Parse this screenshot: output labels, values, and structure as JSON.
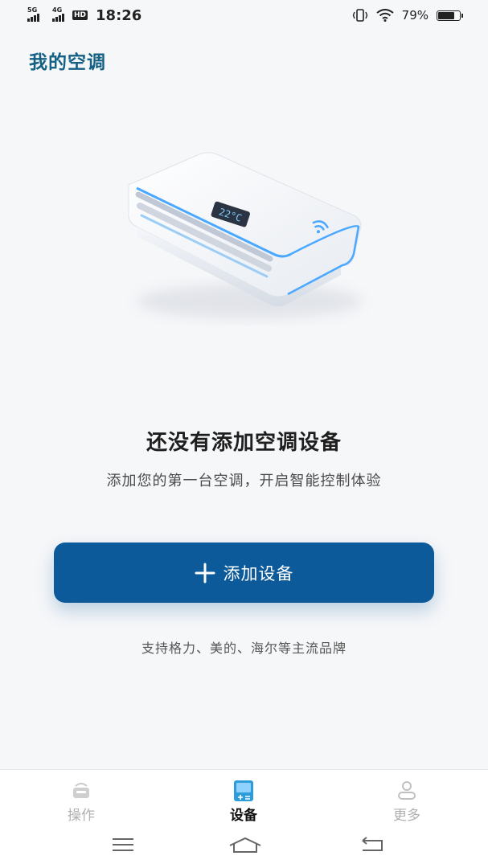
{
  "status_bar": {
    "sim1": "5G",
    "sim2": "4G",
    "hd": "HD",
    "time": "18:26",
    "battery_percent": "79%",
    "battery_level": 0.79
  },
  "header": {
    "title": "我的空调"
  },
  "empty_state": {
    "title": "还没有添加空调设备",
    "subtitle": "添加您的第一台空调，开启智能控制体验",
    "illustration_display": "22°C"
  },
  "add_button": {
    "icon": "plus-icon",
    "label": "添加设备"
  },
  "brand_note": "支持格力、美的、海尔等主流品牌",
  "bottom_nav": {
    "tabs": [
      {
        "label": "操作",
        "icon": "remote-icon",
        "active": false
      },
      {
        "label": "设备",
        "icon": "device-icon",
        "active": true
      },
      {
        "label": "更多",
        "icon": "user-icon",
        "active": false
      }
    ]
  },
  "colors": {
    "accent": "#0d5a9a",
    "title": "#156184",
    "inactive": "#b0b0b0",
    "device_icon": "#2d9cdb"
  }
}
